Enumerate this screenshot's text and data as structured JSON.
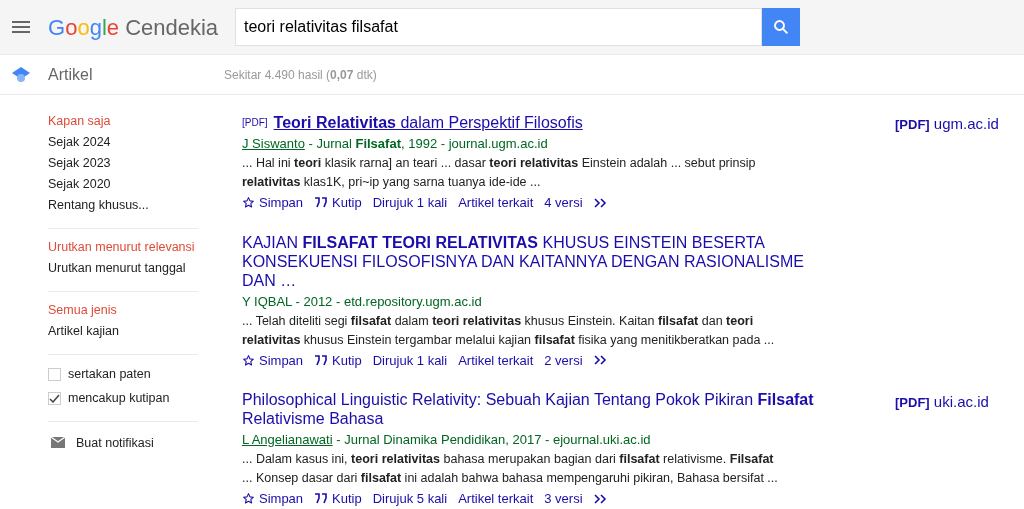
{
  "header": {
    "logo": {
      "brand": "Google",
      "product": "Cendekia"
    },
    "search": {
      "value": "teori relativitas filsafat"
    }
  },
  "subbar": {
    "section": "Artikel",
    "stats": "Sekitar 4.490 hasil (**0,07** dtk)"
  },
  "sidebar": {
    "groups": [
      {
        "items": [
          {
            "label": "Kapan saja",
            "selected": true
          },
          {
            "label": "Sejak 2024",
            "selected": false
          },
          {
            "label": "Sejak 2023",
            "selected": false
          },
          {
            "label": "Sejak 2020",
            "selected": false
          },
          {
            "label": "Rentang khusus...",
            "selected": false
          }
        ]
      },
      {
        "items": [
          {
            "label": "Urutkan menurut relevansi",
            "selected": true
          },
          {
            "label": "Urutkan menurut tanggal",
            "selected": false
          }
        ]
      },
      {
        "items": [
          {
            "label": "Semua jenis",
            "selected": true
          },
          {
            "label": "Artikel kajian",
            "selected": false
          }
        ]
      }
    ],
    "checkboxes": [
      {
        "label": "sertakan paten",
        "checked": false
      },
      {
        "label": "mencakup kutipan",
        "checked": true
      }
    ],
    "alert": "Buat notifikasi"
  },
  "results": [
    {
      "pdf_tag": "[PDF]",
      "title": "**Teori Relativitas** dalam Perspektif Filosofis",
      "hovered": true,
      "author": "J Siswanto",
      "author_linked": true,
      "source": " - Jurnal **Filsafat**, 1992 - journal.ugm.ac.id",
      "snippet": [
        "... Hal ini **teori** klasik rarna] an teari ... dasar **teori relativitas** Einstein adalah ... sebut prinsip",
        "**relativitas** klas1K, pri~ip yang sarna tuanya ide-ide ..."
      ],
      "actions": [
        "Simpan",
        "Kutip",
        "Dirujuk 1 kali",
        "Artikel terkait",
        "4 versi"
      ],
      "side_link": {
        "tag": "[PDF]",
        "domain": "ugm.ac.id"
      }
    },
    {
      "title": "KAJIAN **FILSAFAT TEORI RELATIVITAS** KHUSUS EINSTEIN BESERTA KONSEKUENSI FILOSOFISNYA DAN KAITANNYA DENGAN RASIONALISME DAN …",
      "hovered": false,
      "author": "Y IQBAL",
      "author_linked": false,
      "source": " - 2012 - etd.repository.ugm.ac.id",
      "snippet": [
        "... Telah diteliti segi **filsafat** dalam **teori relativitas** khusus Einstein. Kaitan **filsafat** dan **teori**",
        "**relativitas** khusus Einstein tergambar melalui kajian **filsafat** fisika yang menitikberatkan pada ..."
      ],
      "actions": [
        "Simpan",
        "Kutip",
        "Dirujuk 1 kali",
        "Artikel terkait",
        "2 versi"
      ]
    },
    {
      "title": "Philosophical Linguistic Relativity: Sebuah Kajian Tentang Pokok Pikiran **Filsafat** Relativisme Bahasa",
      "hovered": false,
      "author": "L Angelianawati",
      "author_linked": true,
      "source": " - Jurnal Dinamika Pendidikan, 2017 - ejournal.uki.ac.id",
      "snippet": [
        "... Dalam kasus ini, **teori relativitas** bahasa merupakan bagian dari **filsafat** relativisme. **Filsafat**",
        "... Konsep dasar dari **filsafat** ini adalah bahwa bahasa mempengaruhi pikiran, Bahasa bersifat ..."
      ],
      "actions": [
        "Simpan",
        "Kutip",
        "Dirujuk 5 kali",
        "Artikel terkait",
        "3 versi"
      ],
      "side_link": {
        "tag": "[PDF]",
        "domain": "uki.ac.id"
      }
    }
  ]
}
